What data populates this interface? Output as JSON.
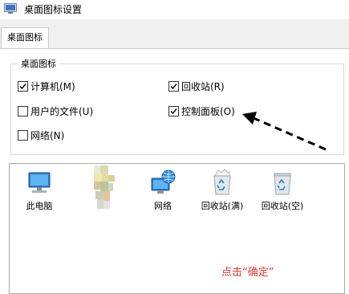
{
  "window": {
    "title": "桌面图标设置"
  },
  "tabs": [
    {
      "label": "桌面图标"
    }
  ],
  "group": {
    "label": "桌面图标",
    "checkboxes": [
      {
        "label": "计算机(M)",
        "checked": true
      },
      {
        "label": "回收站(R)",
        "checked": true
      },
      {
        "label": "用户的文件(U)",
        "checked": false
      },
      {
        "label": "控制面板(O)",
        "checked": true
      },
      {
        "label": "网络(N)",
        "checked": false
      }
    ]
  },
  "icons": [
    {
      "label": "此电脑",
      "icon": "computer-icon"
    },
    {
      "label": "",
      "icon": "user-files-icon"
    },
    {
      "label": "网络",
      "icon": "network-icon"
    },
    {
      "label": "回收站(满)",
      "icon": "recycle-bin-full-icon"
    },
    {
      "label": "回收站(空)",
      "icon": "recycle-bin-empty-icon"
    }
  ],
  "annotation": {
    "text": "点击“确定”",
    "color": "#e2392f"
  }
}
